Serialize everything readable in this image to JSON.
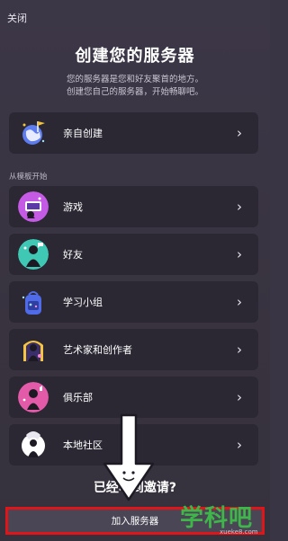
{
  "header": {
    "close_label": "关闭"
  },
  "intro": {
    "title": "创建您的服务器",
    "subtitle_line1": "您的服务器是您和好友聚首的地方。",
    "subtitle_line2": "创建您自己的服务器，开始畅聊吧。"
  },
  "create_own": {
    "label": "亲自创建",
    "icon": "globe-flag-icon"
  },
  "templates": {
    "section_label": "从模板开始",
    "items": [
      {
        "label": "游戏",
        "icon": "gaming-icon"
      },
      {
        "label": "好友",
        "icon": "friends-icon"
      },
      {
        "label": "学习小组",
        "icon": "study-group-icon"
      },
      {
        "label": "艺术家和创作者",
        "icon": "artist-icon"
      },
      {
        "label": "俱乐部",
        "icon": "club-icon"
      },
      {
        "label": "本地社区",
        "icon": "local-community-icon"
      }
    ]
  },
  "footer": {
    "invite_text": "已经收到邀请?",
    "join_button_label": "加入服务器"
  },
  "watermark": {
    "main": "学科吧",
    "sub": "xueke8.com"
  },
  "colors": {
    "background": "#3a3545",
    "card": "#2b2833",
    "highlight_border": "#e0151a",
    "watermark": "#3fb64a"
  }
}
